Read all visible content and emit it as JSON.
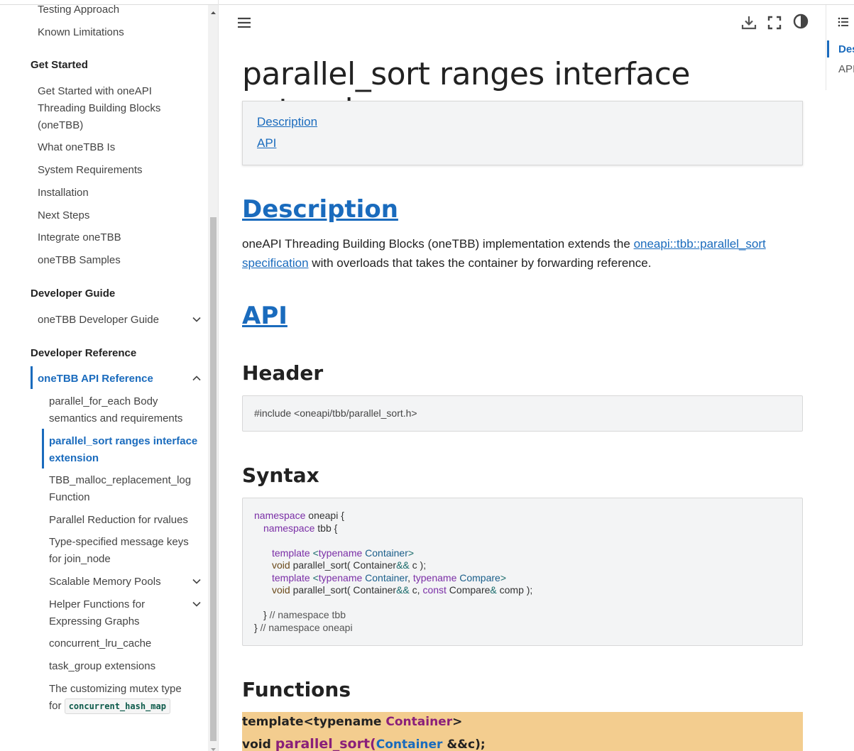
{
  "sidebar": {
    "top_items": [
      "Testing Approach",
      "Known Limitations"
    ],
    "get_started": {
      "heading": "Get Started",
      "items": [
        "Get Started with oneAPI Threading Building Blocks (oneTBB)",
        "What oneTBB Is",
        "System Requirements",
        "Installation",
        "Next Steps",
        "Integrate oneTBB",
        "oneTBB Samples"
      ]
    },
    "developer_guide": {
      "heading": "Developer Guide",
      "items": [
        "oneTBB Developer Guide"
      ]
    },
    "developer_reference": {
      "heading": "Developer Reference",
      "active_section": "oneTBB API Reference",
      "items": [
        "parallel_for_each Body semantics and requirements",
        "parallel_sort ranges interface extension",
        "TBB_malloc_replacement_log Function",
        "Parallel Reduction for rvalues",
        "Type-specified message keys for join_node",
        "Scalable Memory Pools",
        "Helper Functions for Expressing Graphs",
        "concurrent_lru_cache",
        "task_group extensions",
        "The customizing mutex type for"
      ],
      "last_item_code": "concurrent_hash_map"
    }
  },
  "toolbar": {
    "menu_icon": "hamburger-icon",
    "download_icon": "download-icon",
    "fullscreen_icon": "fullscreen-icon",
    "theme_icon": "contrast-icon"
  },
  "page": {
    "title": "parallel_sort ranges interface extension",
    "toc": [
      "Description",
      "API"
    ],
    "description_heading": "Description",
    "description_text_1": "oneAPI Threading Building Blocks (oneTBB) implementation extends the ",
    "description_link": "oneapi::tbb::parallel_sort specification",
    "description_text_2": " with overloads that takes the container by forwarding reference.",
    "api_heading": "API",
    "header_heading": "Header",
    "header_code": "#include <oneapi/tbb/parallel_sort.h>",
    "syntax_heading": "Syntax",
    "functions_heading": "Functions",
    "signature_line1_a": "template<typename ",
    "signature_line1_b": "Container",
    "signature_line1_c": ">",
    "signature_line2_a": "void ",
    "signature_line2_b": "parallel_sort",
    "signature_line2_c": "(",
    "signature_line2_d": "Container",
    "signature_line2_e": " &&c);"
  },
  "right_toc": {
    "icon": "list-icon",
    "items": [
      "Des",
      "API"
    ]
  },
  "colors": {
    "accent": "#1a6bbd",
    "signature_bg": "#f3cd8f",
    "code_bg": "#f3f4f5"
  }
}
